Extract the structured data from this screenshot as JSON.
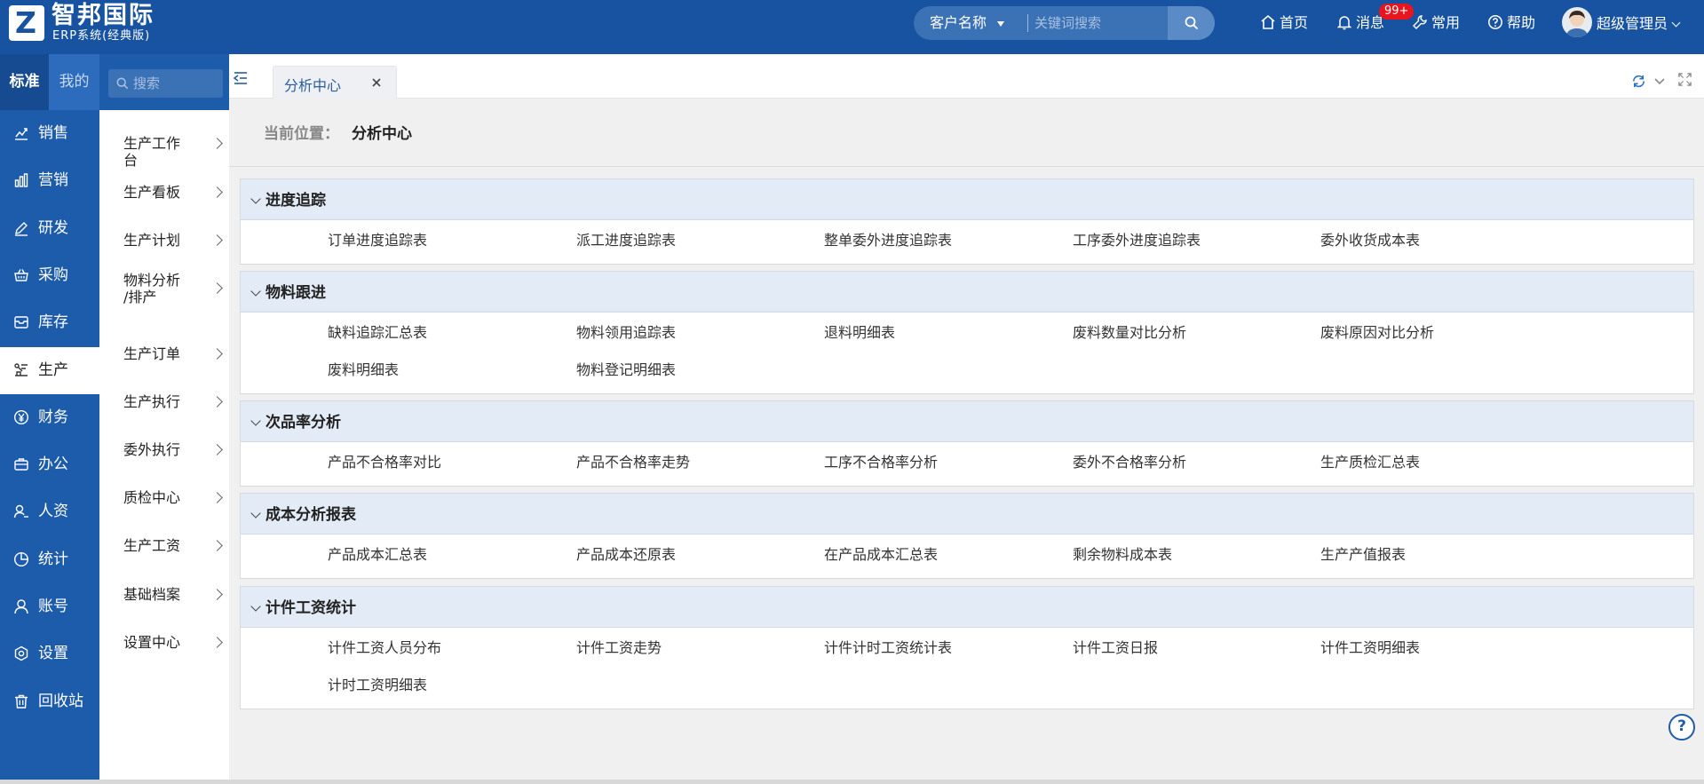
{
  "header": {
    "logo_letter": "Z",
    "brand_name": "智邦国际",
    "brand_sub": "ERP系统(经典版)",
    "search": {
      "type_label": "客户名称",
      "placeholder": "关键词搜索"
    },
    "nav": {
      "home": "首页",
      "messages": "消息",
      "messages_badge": "99+",
      "favorites": "常用",
      "help": "帮助"
    },
    "user": {
      "name": "超级管理员"
    }
  },
  "sidebar": {
    "tabs": {
      "standard": "标准",
      "mine": "我的"
    },
    "search_placeholder": "搜索",
    "items": [
      {
        "label": "销售",
        "icon": "sales-chart-icon"
      },
      {
        "label": "营销",
        "icon": "bar-chart-icon"
      },
      {
        "label": "研发",
        "icon": "rd-pencil-icon"
      },
      {
        "label": "采购",
        "icon": "basket-icon"
      },
      {
        "label": "库存",
        "icon": "inventory-box-icon"
      },
      {
        "label": "生产",
        "icon": "production-icon",
        "active": true
      },
      {
        "label": "财务",
        "icon": "yen-icon"
      },
      {
        "label": "办公",
        "icon": "briefcase-icon"
      },
      {
        "label": "人资",
        "icon": "person-icon"
      },
      {
        "label": "统计",
        "icon": "pie-icon"
      },
      {
        "label": "账号",
        "icon": "user-icon"
      },
      {
        "label": "设置",
        "icon": "hexagon-settings-icon"
      },
      {
        "label": "回收站",
        "icon": "trash-icon"
      }
    ]
  },
  "submenu": {
    "items": [
      "生产工作台",
      "生产看板",
      "生产计划",
      "物料分析\n/排产",
      "生产订单",
      "生产执行",
      "委外执行",
      "质检中心",
      "生产工资",
      "基础档案",
      "设置中心"
    ]
  },
  "tabs": {
    "active_label": "分析中心"
  },
  "breadcrumb": {
    "label": "当前位置：",
    "value": "分析中心"
  },
  "sections": [
    {
      "title": "进度追踪",
      "links": [
        "订单进度追踪表",
        "派工进度追踪表",
        "整单委外进度追踪表",
        "工序委外进度追踪表",
        "委外收货成本表"
      ]
    },
    {
      "title": "物料跟进",
      "links": [
        "缺料追踪汇总表",
        "物料领用追踪表",
        "退料明细表",
        "废料数量对比分析",
        "废料原因对比分析",
        "废料明细表",
        "物料登记明细表"
      ]
    },
    {
      "title": "次品率分析",
      "links": [
        "产品不合格率对比",
        "产品不合格率走势",
        "工序不合格率分析",
        "委外不合格率分析",
        "生产质检汇总表"
      ]
    },
    {
      "title": "成本分析报表",
      "links": [
        "产品成本汇总表",
        "产品成本还原表",
        "在产品成本汇总表",
        "剩余物料成本表",
        "生产产值报表"
      ]
    },
    {
      "title": "计件工资统计",
      "links": [
        "计件工资人员分布",
        "计件工资走势",
        "计件计时工资统计表",
        "计件工资日报",
        "计件工资明细表",
        "计时工资明细表"
      ]
    }
  ],
  "help_fab": "?",
  "colors": {
    "brand": "#1753a0",
    "sidebar": "#1d5bab",
    "section_header": "#e3ebf7",
    "badge": "#e8141e"
  }
}
